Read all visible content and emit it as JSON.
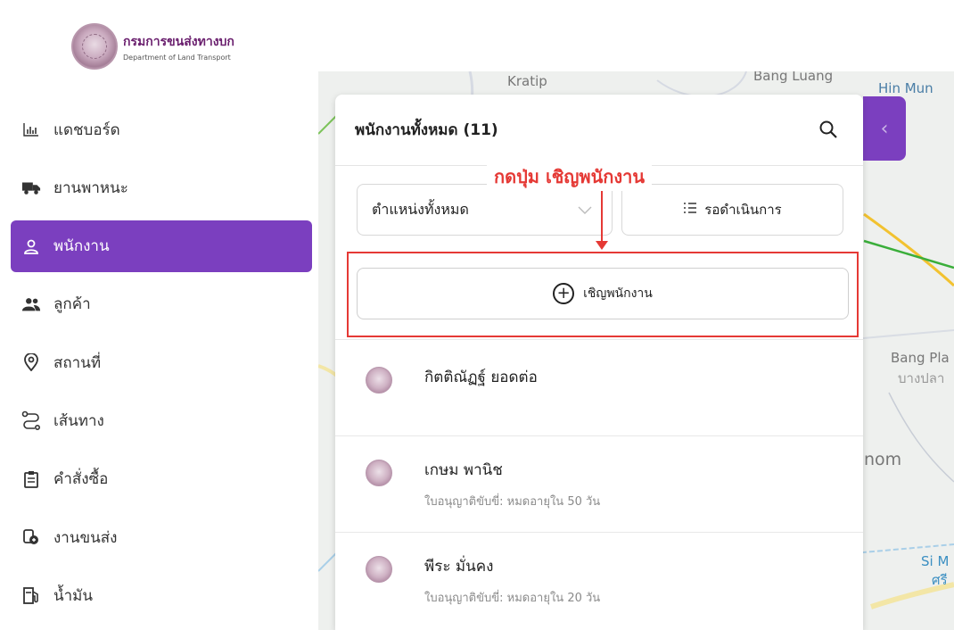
{
  "brand": {
    "name_th": "กรมการขนส่งทางบก",
    "name_en": "Department of Land Transport"
  },
  "sidebar": {
    "items": [
      {
        "label": "แดชบอร์ด",
        "icon": "bar-chart-icon"
      },
      {
        "label": "ยานพาหนะ",
        "icon": "truck-icon"
      },
      {
        "label": "พนักงาน",
        "icon": "user-icon",
        "active": true
      },
      {
        "label": "ลูกค้า",
        "icon": "users-icon"
      },
      {
        "label": "สถานที่",
        "icon": "location-pin-icon"
      },
      {
        "label": "เส้นทาง",
        "icon": "route-icon"
      },
      {
        "label": "คำสั่งซื้อ",
        "icon": "clipboard-icon"
      },
      {
        "label": "งานขนส่ง",
        "icon": "delivery-icon"
      },
      {
        "label": "น้ำมัน",
        "icon": "fuel-icon"
      }
    ]
  },
  "map": {
    "labels": [
      "Kratip",
      "Bang Luang",
      "Hin Mun",
      "Bang Pla",
      "บางปลา",
      "nom",
      "Si M",
      "ศรี"
    ]
  },
  "panel": {
    "title": "พนักงานทั้งหมด (11)",
    "position_filter": "ตำแหน่งทั้งหมด",
    "status_filter": "รอดำเนินการ",
    "invite_label": "เชิญพนักงาน",
    "employees": [
      {
        "name": "กิตติณัฏฐ์ ยอดต่อ",
        "license": ""
      },
      {
        "name": "เกษม พานิช",
        "license": "ใบอนุญาติขับขี่: หมดอายุใน 50 วัน"
      },
      {
        "name": "พีระ มั่นคง",
        "license": "ใบอนุญาติขับขี่: หมดอายุใน 20 วัน"
      }
    ]
  },
  "annotation": {
    "text": "กดปุ่ม เชิญพนักงาน",
    "color": "#e53935"
  },
  "colors": {
    "accent": "#7b3fbf"
  }
}
